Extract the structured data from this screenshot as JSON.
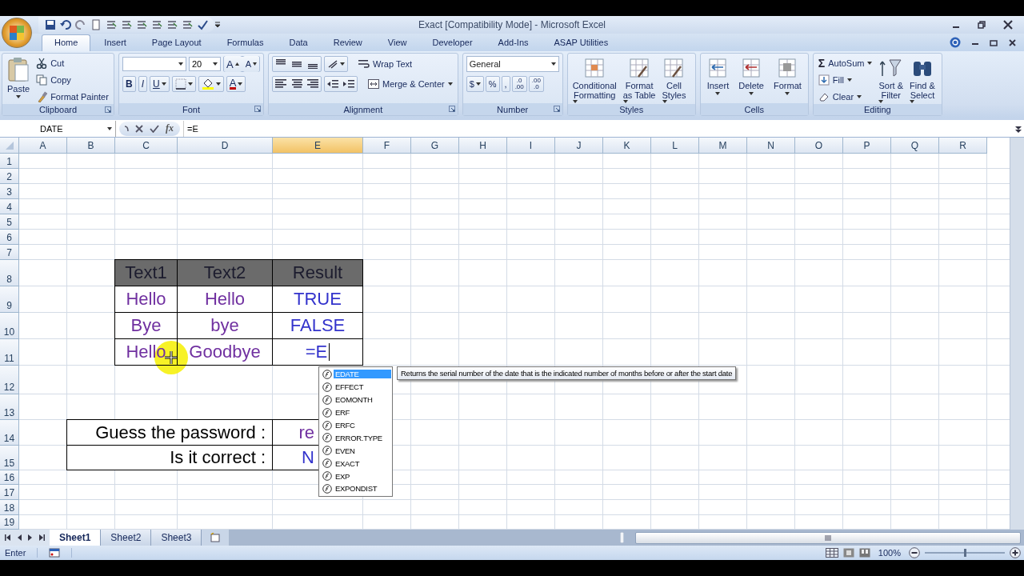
{
  "window": {
    "title": "Exact  [Compatibility Mode] - Microsoft Excel"
  },
  "ribbon_tabs": [
    {
      "label": "Home",
      "selected": true
    },
    {
      "label": "Insert",
      "selected": false
    },
    {
      "label": "Page Layout",
      "selected": false
    },
    {
      "label": "Formulas",
      "selected": false
    },
    {
      "label": "Data",
      "selected": false
    },
    {
      "label": "Review",
      "selected": false
    },
    {
      "label": "View",
      "selected": false
    },
    {
      "label": "Developer",
      "selected": false
    },
    {
      "label": "Add-Ins",
      "selected": false
    },
    {
      "label": "ASAP Utilities",
      "selected": false
    }
  ],
  "clipboard": {
    "title": "Clipboard",
    "paste": "Paste",
    "cut": "Cut",
    "copy": "Copy",
    "format_painter": "Format Painter"
  },
  "font": {
    "title": "Font",
    "font_size": "20",
    "grow": "A",
    "shrink": "A",
    "bold": "B",
    "italic": "I",
    "underline": "U",
    "font_color": "A"
  },
  "alignment": {
    "title": "Alignment",
    "wrap_text": "Wrap Text",
    "merge_center": "Merge & Center"
  },
  "number": {
    "title": "Number",
    "format": "General",
    "currency": "$",
    "percent": "%",
    "comma": ",",
    "decimals": [
      {
        "top": ".0",
        "bottom": ".00"
      },
      {
        "top": ".00",
        "bottom": ".0"
      }
    ]
  },
  "styles": {
    "title": "Styles",
    "buttons": [
      "Conditional\nFormatting",
      "Format\nas Table",
      "Cell\nStyles"
    ]
  },
  "cells_group": {
    "title": "Cells",
    "buttons": [
      "Insert",
      "Delete",
      "Format"
    ]
  },
  "editing": {
    "title": "Editing",
    "sigma": "Σ",
    "autosum": "AutoSum",
    "fill": "Fill",
    "clear": "Clear",
    "sort_filter": "Sort &\nFilter",
    "find_select": "Find &\nSelect"
  },
  "formula_bar": {
    "name_box": "DATE",
    "fx": "fx",
    "formula": "=E"
  },
  "columns": [
    {
      "label": "A",
      "selected": false
    },
    {
      "label": "B",
      "selected": false
    },
    {
      "label": "C",
      "selected": false
    },
    {
      "label": "D",
      "selected": false
    },
    {
      "label": "E",
      "selected": true
    },
    {
      "label": "F",
      "selected": false
    },
    {
      "label": "G",
      "selected": false
    },
    {
      "label": "H",
      "selected": false
    },
    {
      "label": "I",
      "selected": false
    },
    {
      "label": "J",
      "selected": false
    },
    {
      "label": "K",
      "selected": false
    },
    {
      "label": "L",
      "selected": false
    },
    {
      "label": "M",
      "selected": false
    },
    {
      "label": "N",
      "selected": false
    },
    {
      "label": "O",
      "selected": false
    },
    {
      "label": "P",
      "selected": false
    },
    {
      "label": "Q",
      "selected": false
    },
    {
      "label": "R",
      "selected": false
    }
  ],
  "rows": [
    {
      "label": "1",
      "cells": []
    },
    {
      "label": "2",
      "cells": []
    },
    {
      "label": "3",
      "cells": []
    },
    {
      "label": "4",
      "cells": []
    },
    {
      "label": "5",
      "cells": []
    },
    {
      "label": "6",
      "cells": []
    },
    {
      "label": "7",
      "cells": []
    },
    {
      "label": "8",
      "cells": [
        null,
        null,
        {
          "text": "Text1",
          "kind": "header"
        },
        {
          "text": "Text2",
          "kind": "header"
        },
        {
          "text": "Result",
          "kind": "header"
        }
      ]
    },
    {
      "label": "9",
      "cells": [
        null,
        null,
        {
          "text": "Hello",
          "kind": "value",
          "color": "#7030a0"
        },
        {
          "text": "Hello",
          "kind": "value",
          "color": "#7030a0"
        },
        {
          "text": "TRUE",
          "kind": "value",
          "color": "#3333cc"
        }
      ]
    },
    {
      "label": "10",
      "cells": [
        null,
        null,
        {
          "text": "Bye",
          "kind": "value",
          "color": "#7030a0"
        },
        {
          "text": "bye",
          "kind": "value",
          "color": "#7030a0"
        },
        {
          "text": "FALSE",
          "kind": "value",
          "color": "#3333cc"
        }
      ]
    },
    {
      "label": "11",
      "cells": [
        null,
        null,
        {
          "text": "Hello",
          "kind": "value",
          "color": "#7030a0"
        },
        {
          "text": "Goodbye",
          "kind": "value",
          "color": "#7030a0"
        },
        {
          "text": "=E",
          "kind": "editing",
          "color": "#3333cc"
        }
      ]
    },
    {
      "label": "12",
      "cells": []
    },
    {
      "label": "13",
      "cells": []
    },
    {
      "label": "14",
      "cells": [
        null,
        {
          "text": "Guess the password :",
          "kind": "label"
        },
        {
          "kind": "merged"
        },
        {
          "kind": "merged"
        },
        {
          "text": "re",
          "kind": "partial",
          "color": "#7030a0"
        }
      ]
    },
    {
      "label": "15",
      "cells": [
        null,
        {
          "text": "Is it correct :",
          "kind": "label"
        },
        {
          "kind": "merged"
        },
        {
          "kind": "merged"
        },
        {
          "text": "N",
          "kind": "partial",
          "color": "#3333cc"
        }
      ]
    },
    {
      "label": "16",
      "cells": []
    },
    {
      "label": "17",
      "cells": []
    },
    {
      "label": "18",
      "cells": []
    },
    {
      "label": "19",
      "cells": []
    }
  ],
  "autocomplete": {
    "items": [
      {
        "label": "EDATE",
        "selected": true
      },
      {
        "label": "EFFECT",
        "selected": false
      },
      {
        "label": "EOMONTH",
        "selected": false
      },
      {
        "label": "ERF",
        "selected": false
      },
      {
        "label": "ERFC",
        "selected": false
      },
      {
        "label": "ERROR.TYPE",
        "selected": false
      },
      {
        "label": "EVEN",
        "selected": false
      },
      {
        "label": "EXACT",
        "selected": false
      },
      {
        "label": "EXP",
        "selected": false
      },
      {
        "label": "EXPONDIST",
        "selected": false
      }
    ],
    "tooltip": "Returns the serial number of the date that is the indicated number of months before or after the start date"
  },
  "sheet_tabs": [
    {
      "label": "Sheet1",
      "selected": true
    },
    {
      "label": "Sheet2",
      "selected": false
    },
    {
      "label": "Sheet3",
      "selected": false
    }
  ],
  "status_bar": {
    "mode": "Enter",
    "zoom": "100%",
    "zoom_slider": {
      "level": 0.5
    }
  }
}
